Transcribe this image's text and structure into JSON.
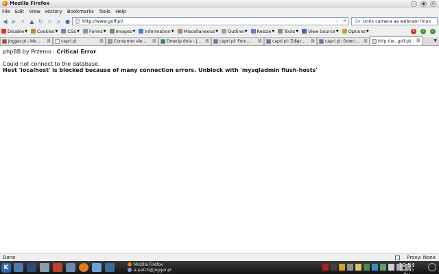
{
  "window": {
    "title": "Mozilla Firefox"
  },
  "menu": [
    "File",
    "Edit",
    "View",
    "History",
    "Bookmarks",
    "Tools",
    "Help"
  ],
  "nav": {
    "url": "http://www.golf.pl/",
    "search_value": "umix camera as webcam linux"
  },
  "devbar": {
    "items": [
      "Disable",
      "Cookies",
      "CSS",
      "Forms",
      "Images",
      "Information",
      "Miscellaneous",
      "Outline",
      "Resize",
      "Tools",
      "View Source",
      "Options"
    ],
    "icon_colors": [
      "#d23a2a",
      "#c08a3c",
      "#6a8fcc",
      "#7a9ac4",
      "#6a9a5a",
      "#4a7fc9",
      "#b08a6a",
      "#a0a0a0",
      "#7a7ac0",
      "#8a8a8a",
      "#3d6ab5",
      "#caa035"
    ]
  },
  "tabs": [
    {
      "label": "Jogger.pl - blo...",
      "icon_color": "#d9362b"
    },
    {
      "label": "capri.pl",
      "icon_color": "#f0f0f0"
    },
    {
      "label": "Consumer ele...",
      "icon_color": "#8aa3c2"
    },
    {
      "label": "Dowcip dnia - j...",
      "icon_color": "#2f8a3a"
    },
    {
      "label": "capri.pl: Foru...",
      "icon_color": "#5a7fb8"
    },
    {
      "label": "capri.pl: Zdjęc...",
      "icon_color": "#5a7fb8"
    },
    {
      "label": "capri.pl: Dowci...",
      "icon_color": "#5a7fb8"
    },
    {
      "label": "http://w...golf.pl/",
      "icon_color": "#d8d8d8",
      "active": true
    }
  ],
  "page": {
    "app_name": "phpBB by Przemo",
    "separator": " : ",
    "heading": "Critical Error",
    "message": "Could not connect to the database.",
    "error": "Host 'localhost' is blocked because of many connection errors. Unblock with 'mysqladmin flush-hosts'"
  },
  "statusbar": {
    "status": "Done",
    "proxy": "Proxy: None"
  },
  "taskbar": {
    "tasks": [
      "Mozilla Firefox",
      "a-patch@jogger.pl"
    ],
    "time": "19:54",
    "date": "Wed, 18 Mar"
  }
}
